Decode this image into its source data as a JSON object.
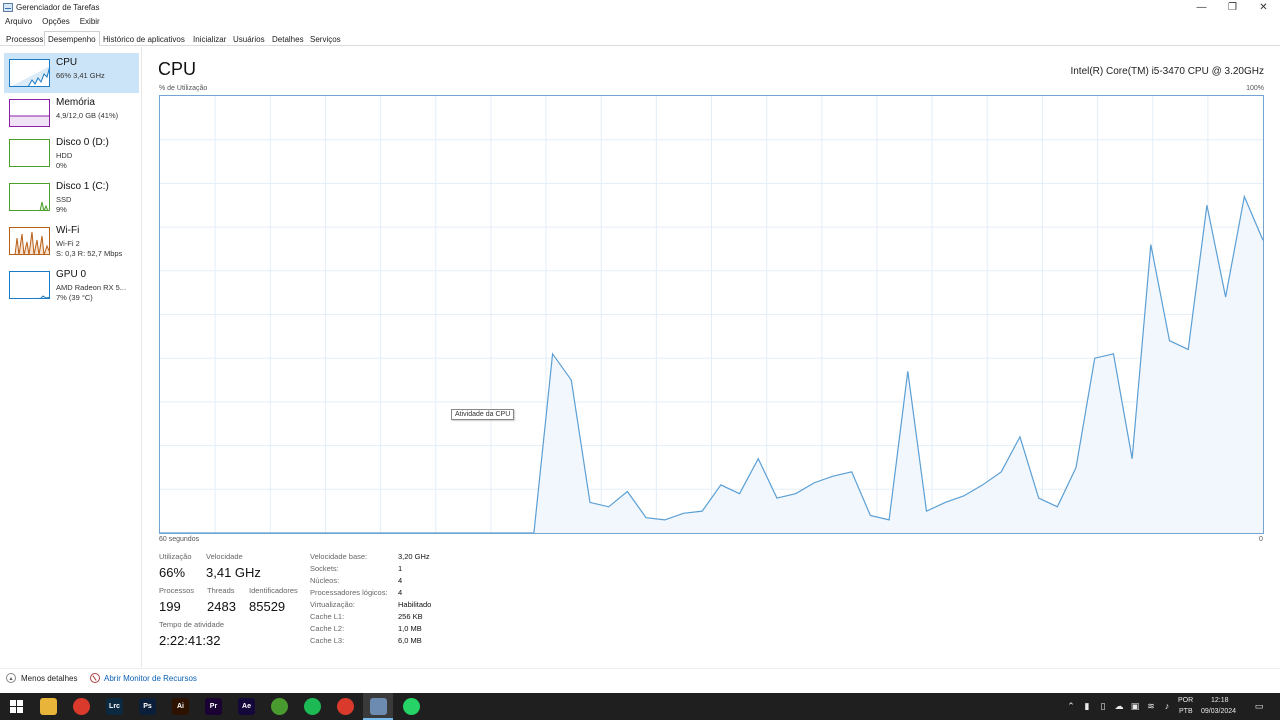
{
  "window": {
    "title": "Gerenciador de Tarefas",
    "controls": {
      "minimize": "—",
      "maximize": "❐",
      "close": "✕"
    }
  },
  "menu": [
    "Arquivo",
    "Opções",
    "Exibir"
  ],
  "tabs": [
    "Processos",
    "Desempenho",
    "Histórico de aplicativos",
    "Inicializar",
    "Usuários",
    "Detalhes",
    "Serviços"
  ],
  "active_tab": "Desempenho",
  "sidebar": [
    {
      "title": "CPU",
      "line1": "66% 3,41 GHz",
      "line2": "",
      "color": "#1b7bc4"
    },
    {
      "title": "Memória",
      "line1": "4,9/12,0 GB (41%)",
      "line2": "",
      "color": "#8b1fa8"
    },
    {
      "title": "Disco 0 (D:)",
      "line1": "HDD",
      "line2": "0%",
      "color": "#4d9e2a"
    },
    {
      "title": "Disco 1 (C:)",
      "line1": "SSD",
      "line2": "9%",
      "color": "#4d9e2a"
    },
    {
      "title": "Wi-Fi",
      "line1": "Wi-Fi 2",
      "line2": "S: 0,3  R: 52,7 Mbps",
      "color": "#b85f16"
    },
    {
      "title": "GPU 0",
      "line1": "AMD Radeon RX 5...",
      "line2": "7% (39 °C)",
      "color": "#1b7bc4"
    }
  ],
  "main": {
    "title": "CPU",
    "cpu_name": "Intel(R) Core(TM) i5-3470 CPU @ 3.20GHz",
    "util_label": "% de Utilização",
    "max_label": "100%",
    "time_label": "60 segundos",
    "zero_label": "0",
    "tooltip": "Atividade da CPU"
  },
  "chart_data": {
    "type": "area",
    "ylim": [
      0,
      100
    ],
    "grid": true,
    "values": [
      0,
      0,
      0,
      0,
      0,
      0,
      0,
      0,
      0,
      0,
      0,
      0,
      0,
      0,
      0,
      0,
      0,
      0,
      0,
      0,
      0,
      0,
      0,
      0,
      0,
      0,
      0,
      0,
      0,
      0,
      0,
      0,
      0,
      0,
      0,
      0,
      0,
      0,
      0,
      0,
      0,
      0,
      0,
      0,
      0,
      0,
      0,
      0,
      0,
      0,
      0,
      0,
      0,
      0,
      0,
      0,
      0,
      0,
      0,
      0,
      0,
      0,
      0,
      0,
      0,
      0,
      0,
      0,
      0,
      0,
      0,
      0,
      0,
      0,
      0,
      0,
      0,
      0,
      0,
      0,
      0,
      0,
      0,
      0,
      0,
      0,
      0,
      0,
      0,
      0,
      0,
      0,
      0,
      0,
      0,
      0,
      0,
      0,
      0,
      0,
      0,
      0,
      0,
      0,
      0,
      0,
      0,
      0,
      0,
      0,
      0,
      0,
      0,
      0,
      0,
      0,
      0,
      0,
      0,
      0
    ],
    "samples": [
      0,
      0,
      0,
      0,
      0,
      0,
      0,
      0,
      0,
      0,
      0,
      0,
      0,
      0,
      0,
      0,
      0,
      0,
      0,
      0,
      0,
      41,
      35,
      7,
      6,
      9.5,
      3.5,
      3,
      4.5,
      5,
      11,
      9,
      17,
      8,
      9,
      11.5,
      13,
      14,
      4,
      3,
      37,
      5,
      7,
      8.5,
      11,
      14,
      22,
      8,
      6,
      15,
      40,
      41,
      17,
      66,
      44,
      42,
      75,
      54,
      77,
      67
    ]
  },
  "stats": {
    "utilization": {
      "label": "Utilização",
      "value": "66%"
    },
    "speed": {
      "label": "Velocidade",
      "value": "3,41 GHz"
    },
    "processes": {
      "label": "Processos",
      "value": "199"
    },
    "threads": {
      "label": "Threads",
      "value": "2483"
    },
    "handles": {
      "label": "Identificadores",
      "value": "85529"
    },
    "uptime": {
      "label": "Tempo de atividade",
      "value": "2:22:41:32"
    }
  },
  "specs": [
    {
      "label": "Velocidade base:",
      "value": "3,20 GHz"
    },
    {
      "label": "Sockets:",
      "value": "1"
    },
    {
      "label": "Núcleos:",
      "value": "4"
    },
    {
      "label": "Processadores lógicos:",
      "value": "4"
    },
    {
      "label": "Virtualização:",
      "value": "Habilitado"
    },
    {
      "label": "Cache L1:",
      "value": "256 KB"
    },
    {
      "label": "Cache L2:",
      "value": "1,0 MB"
    },
    {
      "label": "Cache L3:",
      "value": "6,0 MB"
    }
  ],
  "footer": {
    "less_details": "Menos detalhes",
    "resource_monitor": "Abrir Monitor de Recursos"
  },
  "taskbar": {
    "apps": [
      {
        "name": "file-explorer",
        "glyph": "",
        "color": "#e8b53a"
      },
      {
        "name": "chrome",
        "glyph": "",
        "color": "#d93a2b"
      },
      {
        "name": "lightroom-classic",
        "glyph": "Lrc",
        "color": "#0b2a3f"
      },
      {
        "name": "photoshop",
        "glyph": "Ps",
        "color": "#0b1f3a"
      },
      {
        "name": "illustrator",
        "glyph": "Ai",
        "color": "#2e1200"
      },
      {
        "name": "premiere",
        "glyph": "Pr",
        "color": "#1a0033"
      },
      {
        "name": "after-effects",
        "glyph": "Ae",
        "color": "#14083a"
      },
      {
        "name": "utorrent",
        "glyph": "",
        "color": "#4a9b2f"
      },
      {
        "name": "spotify",
        "glyph": "",
        "color": "#1db954"
      },
      {
        "name": "chrome-2",
        "glyph": "",
        "color": "#d93a2b"
      },
      {
        "name": "task-manager",
        "glyph": "",
        "color": "#6d8bb0"
      },
      {
        "name": "whatsapp",
        "glyph": "",
        "color": "#25d366"
      }
    ],
    "lang_top": "POR",
    "lang_bottom": "PTB",
    "time": "12:18",
    "date": "09/03/2024"
  }
}
